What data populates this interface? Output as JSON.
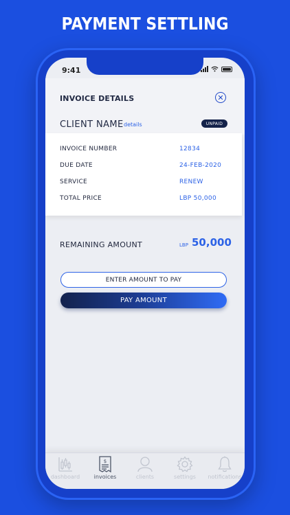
{
  "headline": "PAYMENT SETTLING",
  "status_bar": {
    "time": "9:41"
  },
  "invoice": {
    "title": "INVOICE DETAILS",
    "client_name": "CLIENT NAME",
    "details_link": "details",
    "status_badge": "UNPAID",
    "rows": [
      {
        "label": "INVOICE NUMBER",
        "value": "12834"
      },
      {
        "label": "DUE DATE",
        "value": "24-FEB-2020"
      },
      {
        "label": "SERVICE",
        "value": "RENEW"
      },
      {
        "label": "TOTAL PRICE",
        "value": "LBP 50,000"
      }
    ]
  },
  "remaining": {
    "label": "REMAINING AMOUNT",
    "currency": "LBP",
    "amount": "50,000"
  },
  "payment": {
    "amount_placeholder": "ENTER AMOUNT TO PAY",
    "pay_label": "PAY AMOUNT"
  },
  "tabbar": {
    "active": "invoices",
    "items": [
      {
        "label": "dashboard",
        "icon": "dashboard-chart-icon"
      },
      {
        "label": "invoices",
        "icon": "invoice-icon"
      },
      {
        "label": "clients",
        "icon": "user-icon"
      },
      {
        "label": "settings",
        "icon": "gear-icon"
      },
      {
        "label": "notifications",
        "icon": "bell-icon"
      }
    ]
  },
  "colors": {
    "background": "#1b4fe0",
    "accent": "#2c62e6",
    "dark_navy": "#14224a"
  }
}
